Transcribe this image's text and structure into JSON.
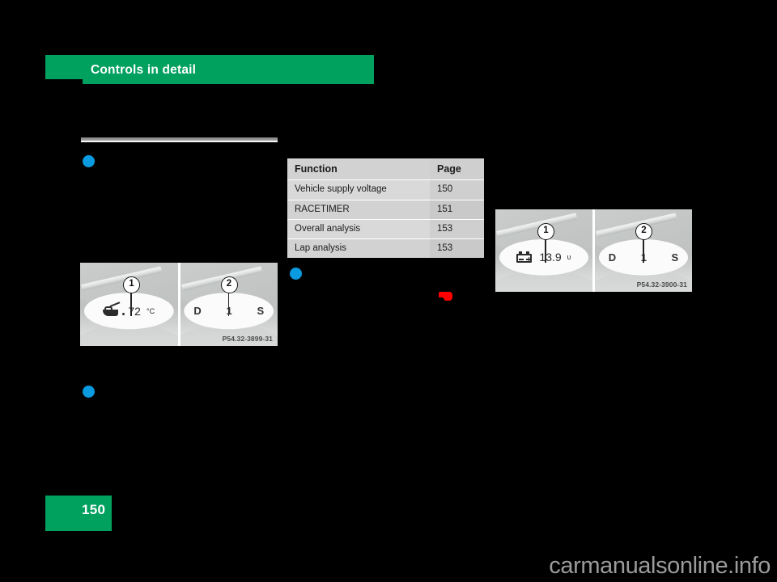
{
  "document": {
    "chapter_title": "Controls in detail",
    "page_number": "150",
    "watermark": "carmanualsonline.info"
  },
  "function_table": {
    "headers": {
      "function": "Function",
      "page": "Page"
    },
    "rows": [
      {
        "function": "Vehicle supply voltage",
        "page": "150"
      },
      {
        "function": "RACETIMER",
        "page": "151"
      },
      {
        "function": "Overall analysis",
        "page": "153"
      },
      {
        "function": "Lap analysis",
        "page": "153"
      }
    ]
  },
  "figures": [
    {
      "id": "figure-oil-temperature",
      "caption": "P54.32-3899-31",
      "panels": [
        {
          "callout": "1",
          "icon": "oil-can-icon",
          "value": "72",
          "unit": "°C"
        },
        {
          "callout": "2",
          "left_label": "D",
          "center_label": "1",
          "right_label": "S"
        }
      ]
    },
    {
      "id": "figure-supply-voltage",
      "caption": "P54.32-3900-31",
      "panels": [
        {
          "callout": "1",
          "icon": "battery-icon",
          "value": "13.9",
          "unit": "υ"
        },
        {
          "callout": "2",
          "left_label": "D",
          "center_label": "1",
          "right_label": "S"
        }
      ]
    }
  ],
  "colors": {
    "brand_green": "#00a05e",
    "bullet_blue": "#0a9ae0",
    "marker_red": "#ff0000",
    "table_header_gray": "#d2d2d2",
    "background": "#000000"
  }
}
